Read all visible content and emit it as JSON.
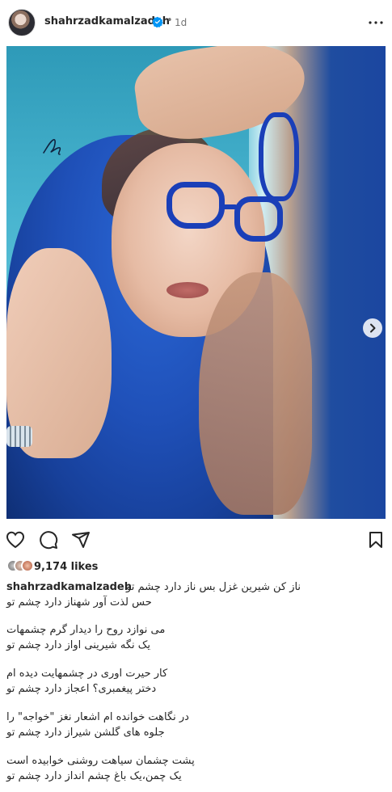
{
  "post": {
    "username": "shahrzadkamalzadeh",
    "separator": "•",
    "time": "1d",
    "likes": "9,174 likes",
    "caption_user": "shahrzadkamalzadeh",
    "caption_lines": [
      "ناز کن شیرین غزل بس ناز دارد چشم تو",
      "حس لذت آور شهناز دارد چشم تو",
      "می نوازد روح را دیدار گرم چشمهات",
      "یک نگه شیرینی اواز دارد چشم تو",
      "کار حیرت اوری در چشمهایت دیده ام",
      "دختر پیغمبری؟ اعجاز دارد چشم تو",
      "در نگاهت خوانده ام اشعار نغز \"خواجه\" را",
      "جلوه های گلشن شیراز دارد چشم تو",
      "پشت چشمان سیاهت روشنی خوابیده است",
      "یک چمن،یک باغ چشم انداز دارد چشم تو"
    ]
  },
  "icons": {
    "verified": "verified-badge-icon",
    "more": "more-options-icon",
    "next": "chevron-right-icon",
    "tag": "user-tag-icon",
    "like": "heart-icon",
    "comment": "comment-icon",
    "share": "share-icon",
    "save": "bookmark-icon"
  },
  "carousel": {
    "count": 2,
    "active": 0
  },
  "colors": {
    "verified": "#0095f6",
    "text": "#262626",
    "muted": "#737373"
  }
}
